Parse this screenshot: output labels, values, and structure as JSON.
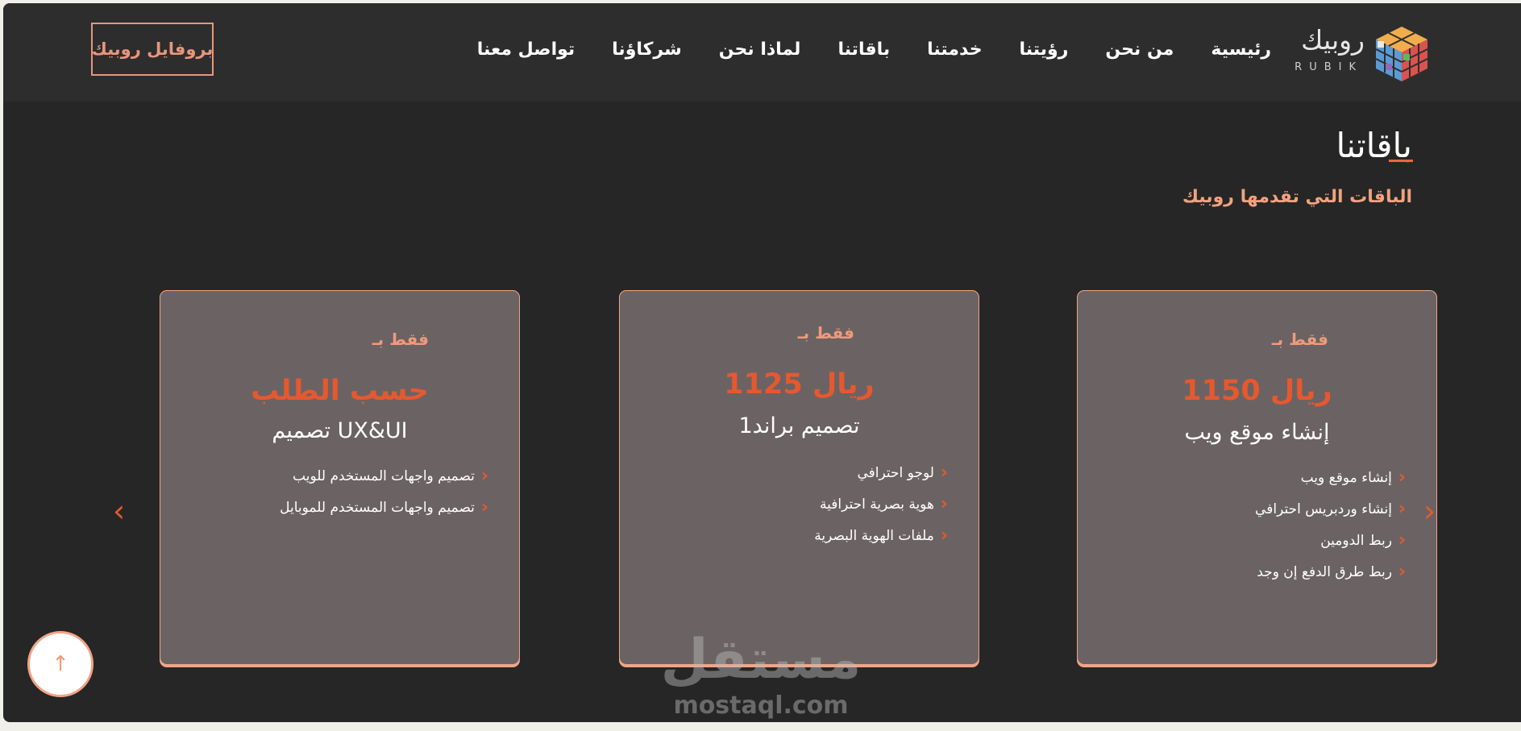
{
  "brand": {
    "name_ar": "روبيك",
    "name_en": "RUBIK",
    "icon": "rubik-cube-logo",
    "colors": [
      "#d9534f",
      "#5cb85c",
      "#f0ad4e",
      "#5b9bd5",
      "#e8e8e8",
      "#8e6bb8"
    ]
  },
  "nav": {
    "items": [
      "رئيسية",
      "من نحن",
      "رؤيتنا",
      "خدمتنا",
      "باقاتنا",
      "لماذا نحن",
      "شركاؤنا",
      "تواصل معنا"
    ],
    "profile_button": "بروفايل روبيك"
  },
  "section": {
    "title": "باقاتنا",
    "subtitle": "الباقات التي تقدمها روبيك"
  },
  "cards": [
    {
      "only": "فقط بـ",
      "price": "1150 ريال",
      "name": "إنشاء موقع ويب",
      "features": [
        "إنشاء موقع ويب",
        "إنشاء وردبريس احترافي",
        "ربط الدومين",
        "ربط طرق الدفع إن وجد"
      ]
    },
    {
      "only": "فقط بـ",
      "price": "1125 ريال",
      "name": "تصميم براند1",
      "features": [
        "لوجو احترافي",
        "هوية بصرية احترافية",
        "ملفات الهوية البصرية"
      ]
    },
    {
      "only": "فقط بـ",
      "price": "حسب الطلب",
      "name": "تصميم UX&UI",
      "features": [
        "تصميم واجهات المستخدم للويب",
        "تصميم واجهات المستخدم للموبايل"
      ]
    }
  ],
  "controls": {
    "prev_icon": "chevron-left-icon",
    "next_icon": "chevron-right-icon",
    "scroll_top_icon": "arrow-up-icon",
    "chevron_glyph": "‹",
    "arrow_left_glyph": "‹",
    "arrow_right_glyph": "›",
    "arrow_up_glyph": "↑"
  },
  "watermark": {
    "ar": "مستقل",
    "en": "mostaql.com"
  },
  "theme": {
    "accent": "#e6582f",
    "accent_light": "#f09a7a",
    "background": "#262626",
    "navbar": "#2d2d2d",
    "card": "#6b6363"
  }
}
